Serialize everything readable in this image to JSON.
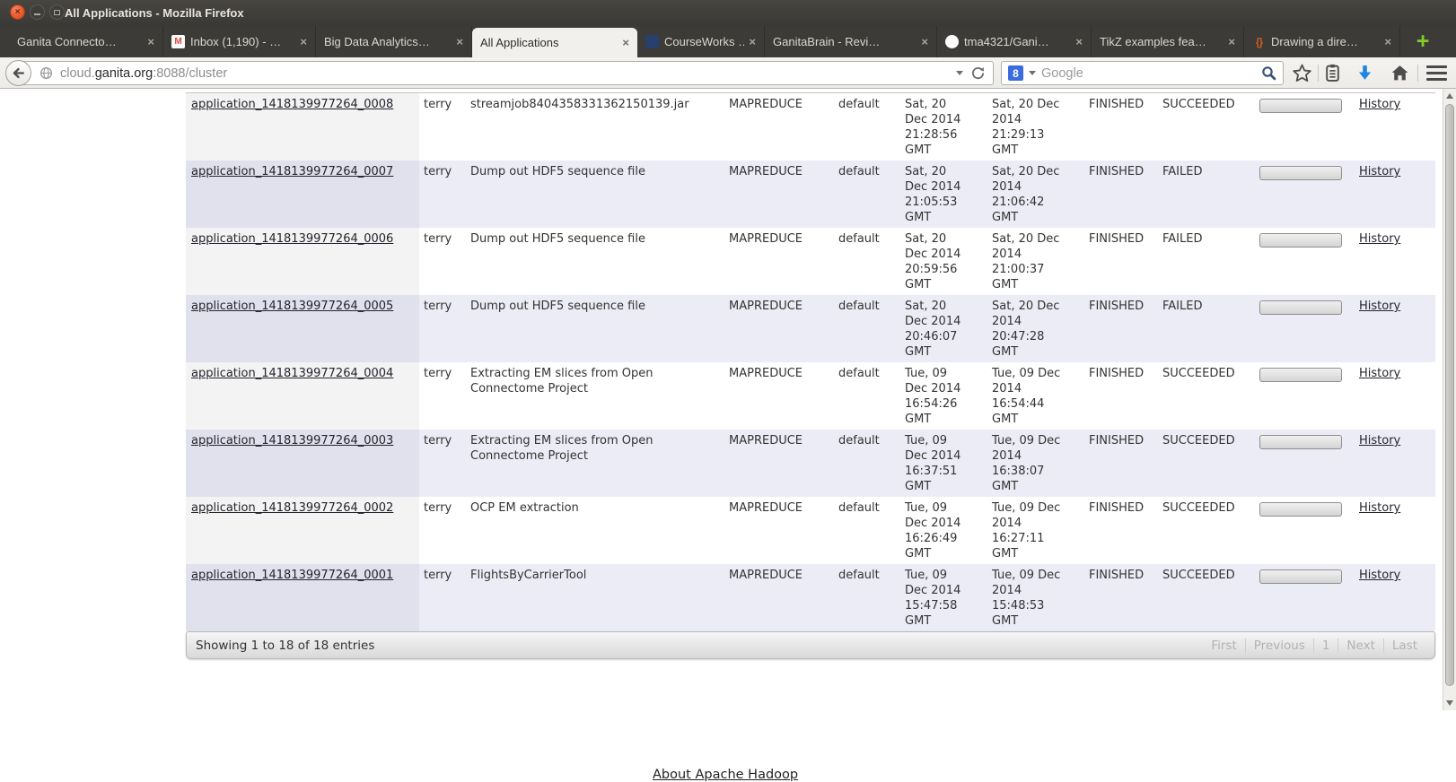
{
  "window": {
    "title": "All Applications - Mozilla Firefox",
    "close_glyph": "×"
  },
  "tabs": {
    "close_glyph": "×",
    "new_tab_label": "+",
    "items": [
      {
        "label": "Ganita Connecto…",
        "icon": ""
      },
      {
        "label": "Inbox (1,190) - …",
        "icon": "gmail"
      },
      {
        "label": "Big Data Analytics…",
        "icon": ""
      },
      {
        "label": "All Applications",
        "icon": "",
        "active": true
      },
      {
        "label": "CourseWorks …",
        "icon": "courseworks"
      },
      {
        "label": "GanitaBrain - Revi…",
        "icon": ""
      },
      {
        "label": "tma4321/Gani…",
        "icon": "github"
      },
      {
        "label": "TikZ examples fea…",
        "icon": ""
      },
      {
        "label": "Drawing a dire…",
        "icon": "braces"
      }
    ]
  },
  "toolbar": {
    "url": {
      "subdomain": "cloud.",
      "domain": "ganita.org",
      "suffix": ":8088/cluster"
    },
    "search": {
      "placeholder": "Google"
    }
  },
  "content": {
    "rows": [
      {
        "id": "application_1418139977264_0008",
        "user": "terry",
        "name": "streamjob8404358331362150139.jar",
        "type": "MAPREDUCE",
        "queue": "default",
        "started": "Sat, 20\nDec 2014\n21:28:56\nGMT",
        "finished": "Sat, 20 Dec\n2014\n21:29:13\nGMT",
        "state": "FINISHED",
        "final_status": "SUCCEEDED",
        "tracking": "History"
      },
      {
        "id": "application_1418139977264_0007",
        "user": "terry",
        "name": "Dump out HDF5 sequence file",
        "type": "MAPREDUCE",
        "queue": "default",
        "started": "Sat, 20\nDec 2014\n21:05:53\nGMT",
        "finished": "Sat, 20 Dec\n2014\n21:06:42\nGMT",
        "state": "FINISHED",
        "final_status": "FAILED",
        "tracking": "History"
      },
      {
        "id": "application_1418139977264_0006",
        "user": "terry",
        "name": "Dump out HDF5 sequence file",
        "type": "MAPREDUCE",
        "queue": "default",
        "started": "Sat, 20\nDec 2014\n20:59:56\nGMT",
        "finished": "Sat, 20 Dec\n2014\n21:00:37\nGMT",
        "state": "FINISHED",
        "final_status": "FAILED",
        "tracking": "History"
      },
      {
        "id": "application_1418139977264_0005",
        "user": "terry",
        "name": "Dump out HDF5 sequence file",
        "type": "MAPREDUCE",
        "queue": "default",
        "started": "Sat, 20\nDec 2014\n20:46:07\nGMT",
        "finished": "Sat, 20 Dec\n2014\n20:47:28\nGMT",
        "state": "FINISHED",
        "final_status": "FAILED",
        "tracking": "History"
      },
      {
        "id": "application_1418139977264_0004",
        "user": "terry",
        "name": "Extracting EM slices from Open Connectome Project",
        "type": "MAPREDUCE",
        "queue": "default",
        "started": "Tue, 09\nDec 2014\n16:54:26\nGMT",
        "finished": "Tue, 09 Dec\n2014\n16:54:44\nGMT",
        "state": "FINISHED",
        "final_status": "SUCCEEDED",
        "tracking": "History"
      },
      {
        "id": "application_1418139977264_0003",
        "user": "terry",
        "name": "Extracting EM slices from Open Connectome Project",
        "type": "MAPREDUCE",
        "queue": "default",
        "started": "Tue, 09\nDec 2014\n16:37:51\nGMT",
        "finished": "Tue, 09 Dec\n2014\n16:38:07\nGMT",
        "state": "FINISHED",
        "final_status": "SUCCEEDED",
        "tracking": "History"
      },
      {
        "id": "application_1418139977264_0002",
        "user": "terry",
        "name": "OCP EM extraction",
        "type": "MAPREDUCE",
        "queue": "default",
        "started": "Tue, 09\nDec 2014\n16:26:49\nGMT",
        "finished": "Tue, 09 Dec\n2014\n16:27:11\nGMT",
        "state": "FINISHED",
        "final_status": "SUCCEEDED",
        "tracking": "History"
      },
      {
        "id": "application_1418139977264_0001",
        "user": "terry",
        "name": "FlightsByCarrierTool",
        "type": "MAPREDUCE",
        "queue": "default",
        "started": "Tue, 09\nDec 2014\n15:47:58\nGMT",
        "finished": "Tue, 09 Dec\n2014\n15:48:53\nGMT",
        "state": "FINISHED",
        "final_status": "SUCCEEDED",
        "tracking": "History"
      }
    ],
    "footer": {
      "info": "Showing 1 to 18 of 18 entries",
      "pagination": [
        "First",
        "Previous",
        "1",
        "Next",
        "Last"
      ]
    },
    "about_link": "About Apache Hadoop"
  },
  "colors": {
    "accent_green": "#85cb28",
    "download_blue": "#1f86e0",
    "even_row": "#ebecf6",
    "gmail_red": "#dd4b39",
    "braces_orange": "#cf5a22"
  }
}
